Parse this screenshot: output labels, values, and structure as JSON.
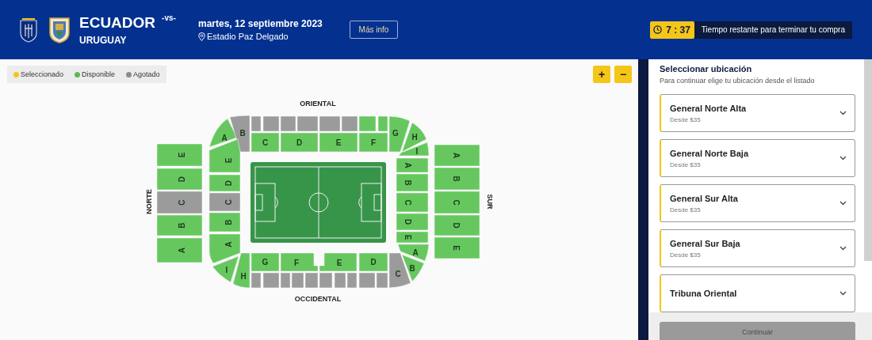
{
  "header": {
    "home_team": "ECUADOR",
    "versus": "-vs-",
    "away_team": "URUGUAY",
    "date": "martes, 12 septiembre 2023",
    "venue": "Estadio Paz Delgado",
    "more_button": "Más info",
    "timer": "7 : 37",
    "timer_text": "Tiempo restante para terminar tu compra"
  },
  "legend": [
    {
      "label": "Seleccionado",
      "color": "#f5c518"
    },
    {
      "label": "Disponible",
      "color": "#5cb85c"
    },
    {
      "label": "Agotado",
      "color": "#8c8c8c"
    }
  ],
  "zoom_buttons": [
    "+",
    "−"
  ],
  "map": {
    "labels": {
      "top": "ORIENTAL",
      "bottom": "OCCIDENTAL",
      "left": "NORTE",
      "right": "SUR"
    },
    "sections": [
      {
        "label": "A",
        "sold_out": false
      },
      {
        "label": "B",
        "sold_out": true
      },
      {
        "sold_out": true
      },
      {
        "sold_out": true
      },
      {
        "sold_out": true
      },
      {
        "sold_out": true
      },
      {
        "sold_out": true
      },
      {
        "sold_out": true
      },
      {
        "sold_out": false
      },
      {
        "sold_out": false
      },
      {
        "label": "C",
        "sold_out": false
      },
      {
        "label": "D",
        "sold_out": false
      },
      {
        "label": "E",
        "sold_out": false
      },
      {
        "label": "F",
        "sold_out": false
      },
      {
        "label": "G",
        "sold_out": false
      },
      {
        "label": "H",
        "sold_out": false
      },
      {
        "label": "I",
        "sold_out": false
      },
      {
        "label": "E",
        "sold_out": false
      },
      {
        "label": "D",
        "sold_out": false
      },
      {
        "label": "C",
        "sold_out": true
      },
      {
        "label": "B",
        "sold_out": false
      },
      {
        "label": "A",
        "sold_out": false
      },
      {
        "label": "E",
        "sold_out": false
      },
      {
        "label": "D",
        "sold_out": false
      },
      {
        "label": "C",
        "sold_out": true
      },
      {
        "label": "B",
        "sold_out": false
      },
      {
        "label": "A",
        "sold_out": false
      },
      {
        "label": "I",
        "sold_out": false
      },
      {
        "label": "H",
        "sold_out": false
      },
      {
        "label": "G",
        "sold_out": false
      },
      {
        "label": "F",
        "sold_out": false
      },
      {
        "label": "E",
        "sold_out": false
      },
      {
        "label": "D",
        "sold_out": false
      },
      {
        "sold_out": true
      },
      {
        "sold_out": true
      },
      {
        "sold_out": true
      },
      {
        "sold_out": true
      },
      {
        "sold_out": true
      },
      {
        "sold_out": true
      },
      {
        "sold_out": true
      },
      {
        "sold_out": true
      },
      {
        "sold_out": true
      },
      {
        "sold_out": true
      },
      {
        "label": "C",
        "sold_out": true
      },
      {
        "label": "B",
        "sold_out": false
      },
      {
        "label": "A",
        "sold_out": false
      },
      {
        "label": "A",
        "sold_out": false
      },
      {
        "label": "B",
        "sold_out": false
      },
      {
        "label": "C",
        "sold_out": false
      },
      {
        "label": "D",
        "sold_out": false
      },
      {
        "label": "E",
        "sold_out": false
      },
      {
        "label": "A",
        "sold_out": false
      },
      {
        "label": "B",
        "sold_out": false
      },
      {
        "label": "C",
        "sold_out": false
      },
      {
        "label": "D",
        "sold_out": false
      },
      {
        "label": "E",
        "sold_out": false
      }
    ]
  },
  "panel": {
    "title": "Seleccionar ubicación",
    "subtitle": "Para continuar elige tu ubicación desde el listado",
    "locations": [
      {
        "name": "General Norte Alta",
        "price": "Desde $35"
      },
      {
        "name": "General Norte Baja",
        "price": "Desde $35"
      },
      {
        "name": "General Sur Alta",
        "price": "Desde $35"
      },
      {
        "name": "General Sur Baja",
        "price": "Desde $35"
      },
      {
        "name": "Tribuna Oriental"
      }
    ],
    "continue_button": {
      "label": "Continuar",
      "disabled": true
    }
  }
}
